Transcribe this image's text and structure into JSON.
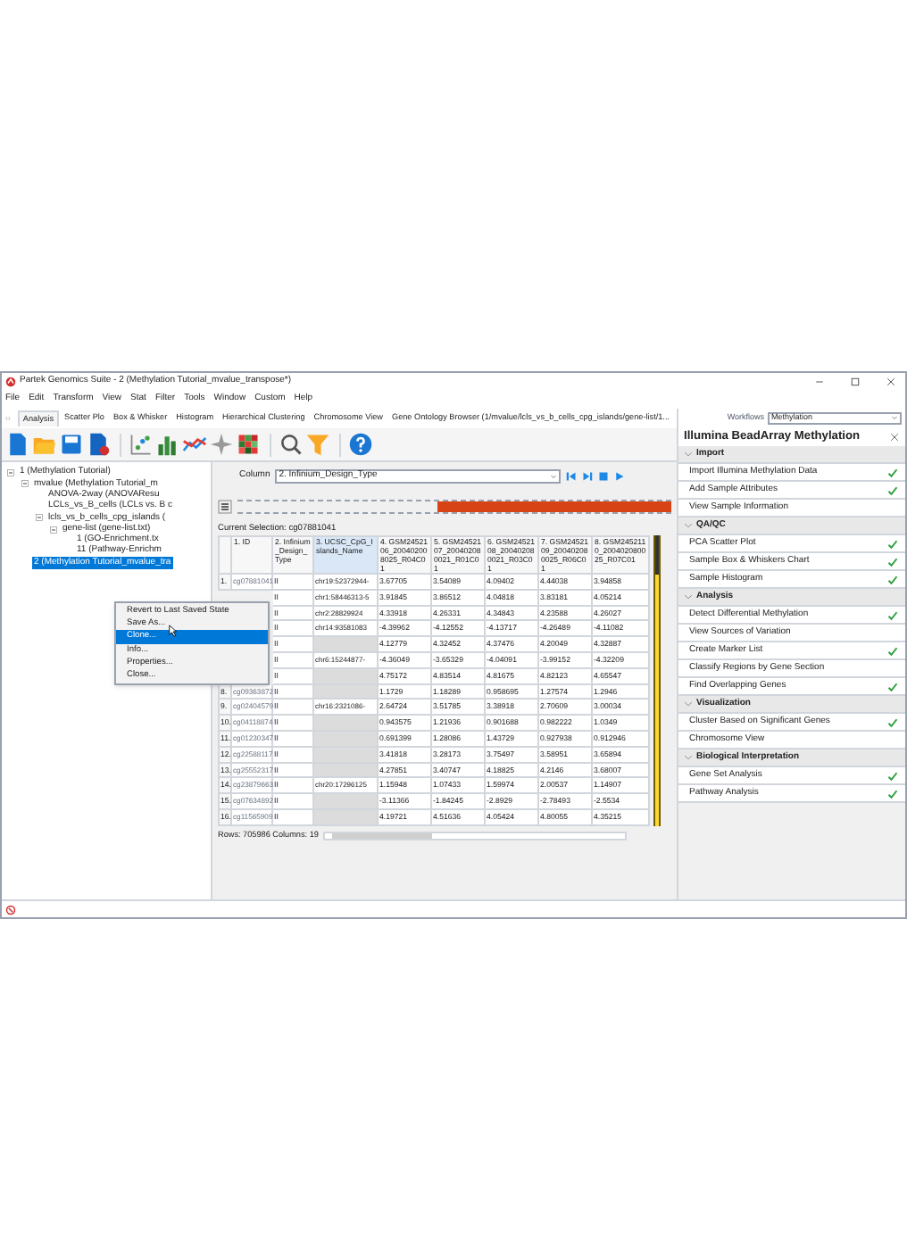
{
  "window": {
    "title": "Partek Genomics Suite - 2 (Methylation Tutorial_mvalue_transpose*)"
  },
  "menu": [
    "File",
    "Edit",
    "Transform",
    "View",
    "Stat",
    "Filter",
    "Tools",
    "Window",
    "Custom",
    "Help"
  ],
  "tabs": [
    {
      "label": "Analysis",
      "selected": true
    },
    {
      "label": "Scatter Plo",
      "selected": false
    },
    {
      "label": "Box & Whisker",
      "selected": false
    },
    {
      "label": "Histogram",
      "selected": false
    },
    {
      "label": "Hierarchical Clustering",
      "selected": false
    },
    {
      "label": "Chromosome View",
      "selected": false
    },
    {
      "label": "Gene Ontology Browser (1/mvalue/lcls_vs_b_cells_cpg_islands/gene-list/1...",
      "selected": false
    }
  ],
  "tree": [
    {
      "label": "1 (Methylation Tutorial)",
      "selected": false,
      "expanded": true,
      "children": [
        {
          "label": "mvalue (Methylation Tutorial_m",
          "selected": false,
          "expanded": true,
          "children": [
            {
              "label": "ANOVA-2way (ANOVAResu",
              "selected": false
            },
            {
              "label": "LCLs_vs_B_cells (LCLs vs. B c",
              "selected": false
            },
            {
              "label": "lcls_vs_b_cells_cpg_islands (",
              "selected": false,
              "expanded": true,
              "children": [
                {
                  "label": "gene-list (gene-list.txt)",
                  "selected": false,
                  "expanded": true,
                  "children": [
                    {
                      "label": "1 (GO-Enrichment.tx",
                      "selected": false
                    },
                    {
                      "label": "11 (Pathway-Enrichm",
                      "selected": false
                    }
                  ]
                }
              ]
            }
          ]
        },
        {
          "label": "2 (Methylation Tutorial_mvalue_tra",
          "selected": true
        }
      ]
    }
  ],
  "context_menu": [
    {
      "label": "Revert to Last Saved State",
      "selected": false
    },
    {
      "label": "Save As...",
      "selected": false
    },
    {
      "label": "Clone...",
      "selected": true
    },
    {
      "label": "Info...",
      "selected": false
    },
    {
      "label": "Properties...",
      "selected": false
    },
    {
      "label": "Close...",
      "selected": false
    }
  ],
  "column_selector": {
    "label": "Column",
    "value": "2. Infinium_Design_Type"
  },
  "current_selection": "Current Selection: cg07881041",
  "table": {
    "columns": [
      {
        "label": "1. ID",
        "selected": false
      },
      {
        "label": "2. Infinium_Design_Type",
        "selected": false
      },
      {
        "label": "3. UCSC_CpG_Islands_Name",
        "selected": true
      },
      {
        "label": "4. GSM2452106_200402008025_R04C01",
        "selected": false
      },
      {
        "label": "5. GSM2452107_200402080021_R01C01",
        "selected": false
      },
      {
        "label": "6. GSM2452108_200402080021_R03C01",
        "selected": false
      },
      {
        "label": "7. GSM2452109_200402080025_R06C01",
        "selected": false
      },
      {
        "label": "8. GSM2452110_200402080025_R07C01",
        "selected": false
      }
    ],
    "rows": [
      {
        "number": "1.",
        "cells": [
          "cg07881041",
          "II",
          "chr19:52372944-",
          "3.67705",
          "3.54089",
          "4.09402",
          "4.44038",
          "3.94858"
        ]
      },
      {
        "cells": [
          "",
          "II",
          "chr1:58446313-5",
          "3.91845",
          "3.86512",
          "4.04818",
          "3.83181",
          "4.05214"
        ]
      },
      {
        "cells": [
          "",
          "II",
          "chr2:28829924",
          "4.33918",
          "4.26331",
          "4.34843",
          "4.23588",
          "4.26027"
        ]
      },
      {
        "cells": [
          "",
          "II",
          "chr14:93581083",
          "-4.39962",
          "-4.12552",
          "-4.13717",
          "-4.26489",
          "-4.11082"
        ]
      },
      {
        "cells": [
          "",
          "II",
          "",
          "4.12779",
          "4.32452",
          "4.37476",
          "4.20049",
          "4.32887"
        ]
      },
      {
        "cells": [
          "",
          "II",
          "chr6:15244877-",
          "-4.36049",
          "-3.65329",
          "-4.04091",
          "-3.99152",
          "-4.32209"
        ]
      },
      {
        "cells": [
          "",
          "II",
          "",
          "4.75172",
          "4.83514",
          "4.81675",
          "4.82123",
          "4.65547"
        ]
      },
      {
        "number": "8.",
        "cells": [
          "cg09363872",
          "II",
          "",
          "1.1729",
          "1.18289",
          "0.958695",
          "1.27574",
          "1.2946"
        ]
      },
      {
        "number": "9.",
        "cells": [
          "cg02404579",
          "II",
          "chr16:2321086-",
          "2.64724",
          "3.51785",
          "3.38918",
          "2.70609",
          "3.00034"
        ]
      },
      {
        "number": "10.",
        "cells": [
          "cg04118874",
          "II",
          "",
          "0.943575",
          "1.21936",
          "0.901688",
          "0.982222",
          "1.0349"
        ]
      },
      {
        "number": "11.",
        "cells": [
          "cg01230347",
          "II",
          "",
          "0.691399",
          "1.28086",
          "1.43729",
          "0.927938",
          "0.912946"
        ]
      },
      {
        "number": "12.",
        "cells": [
          "cg22588117",
          "II",
          "",
          "3.41818",
          "3.28173",
          "3.75497",
          "3.58951",
          "3.65894"
        ]
      },
      {
        "number": "13.",
        "cells": [
          "cg25552317",
          "II",
          "",
          "4.27851",
          "3.40747",
          "4.18825",
          "4.2146",
          "3.68007"
        ]
      },
      {
        "number": "14.",
        "cells": [
          "cg23879663",
          "II",
          "chr20:17296125",
          "1.15948",
          "1.07433",
          "1.59974",
          "2.00537",
          "1.14907"
        ]
      },
      {
        "number": "15.",
        "cells": [
          "cg07634892",
          "II",
          "",
          "-3.11366",
          "-1.84245",
          "-2.8929",
          "-2.78493",
          "-2.5534"
        ]
      },
      {
        "number": "16.",
        "cells": [
          "cg11565909",
          "II",
          "",
          "4.19721",
          "4.51636",
          "4.05424",
          "4.80055",
          "4.35215"
        ]
      }
    ]
  },
  "status": "Rows: 705986 Columns: 19",
  "workflow": {
    "label": "Workflows",
    "value": "Methylation",
    "title": "Illumina BeadArray Methylation",
    "sections": [
      {
        "label": "Import",
        "expanded": true,
        "items": [
          {
            "label": "Import Illumina Methylation Data",
            "checked": true
          },
          {
            "label": "Add Sample Attributes",
            "checked": true
          },
          {
            "label": "View Sample Information",
            "checked": false
          }
        ]
      },
      {
        "label": "QA/QC",
        "expanded": true,
        "items": [
          {
            "label": "PCA Scatter Plot",
            "checked": true
          },
          {
            "label": "Sample Box & Whiskers Chart",
            "checked": true
          },
          {
            "label": "Sample Histogram",
            "checked": true
          }
        ]
      },
      {
        "label": "Analysis",
        "expanded": true,
        "items": [
          {
            "label": "Detect Differential Methylation",
            "checked": true
          },
          {
            "label": "View Sources of Variation",
            "checked": false
          },
          {
            "label": "Create Marker List",
            "checked": true
          },
          {
            "label": "Classify Regions by Gene Section",
            "checked": false
          },
          {
            "label": "Find Overlapping Genes",
            "checked": true
          }
        ]
      },
      {
        "label": "Visualization",
        "expanded": true,
        "items": [
          {
            "label": "Cluster Based on Significant Genes",
            "checked": true
          },
          {
            "label": "Chromosome View",
            "checked": false
          }
        ]
      },
      {
        "label": "Biological Interpretation",
        "expanded": true,
        "items": [
          {
            "label": "Gene Set Analysis",
            "checked": true
          },
          {
            "label": "Pathway Analysis",
            "checked": true
          }
        ]
      }
    ]
  }
}
